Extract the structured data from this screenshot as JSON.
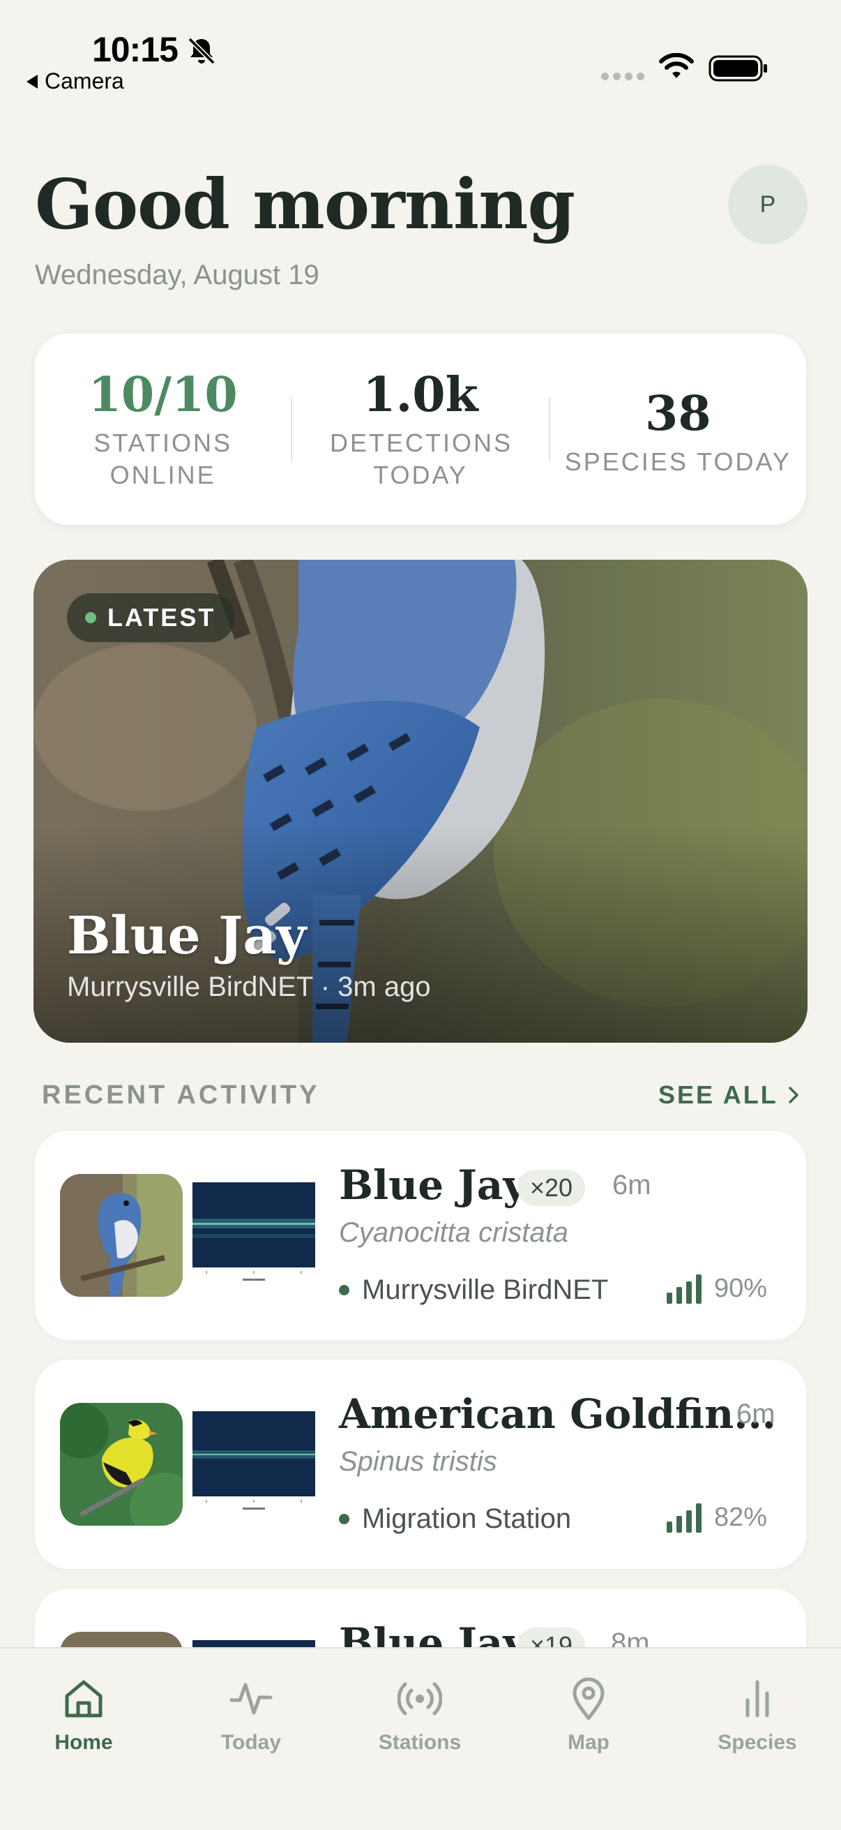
{
  "status_bar": {
    "time": "10:15",
    "back_app": "Camera"
  },
  "header": {
    "greeting": "Good morning",
    "date": "Wednesday, August 19",
    "avatar_initial": "P"
  },
  "stats": [
    {
      "value": "10/10",
      "label": "STATIONS ONLINE",
      "accent": "#4d8a62"
    },
    {
      "value": "1.0k",
      "label": "DETECTIONS TODAY"
    },
    {
      "value": "38",
      "label": "SPECIES TODAY"
    }
  ],
  "hero": {
    "badge": "LATEST",
    "title": "Blue Jay",
    "subtitle": "Murrysville BirdNET · 3m ago"
  },
  "recent": {
    "title": "RECENT ACTIVITY",
    "see_all": "SEE ALL",
    "items": [
      {
        "name": "Blue Jay",
        "count": "×20",
        "ago": "6m",
        "scientific": "Cyanocitta cristata",
        "station": "Murrysville BirdNET",
        "confidence": "90%"
      },
      {
        "name": "American Goldfin...",
        "count": "",
        "ago": "6m",
        "scientific": "Spinus tristis",
        "station": "Migration Station",
        "confidence": "82%"
      },
      {
        "name": "Blue Jay",
        "count": "×19",
        "ago": "8m",
        "scientific": "",
        "station": "",
        "confidence": ""
      }
    ]
  },
  "tabs": [
    {
      "label": "Home",
      "icon": "home-icon",
      "active": true
    },
    {
      "label": "Today",
      "icon": "activity-icon"
    },
    {
      "label": "Stations",
      "icon": "broadcast-icon"
    },
    {
      "label": "Map",
      "icon": "map-pin-icon"
    },
    {
      "label": "Species",
      "icon": "bar-chart-icon"
    }
  ],
  "colors": {
    "background": "#f4f3ee",
    "accent_green": "#3e6a4e",
    "stat_green": "#4d8a62"
  }
}
